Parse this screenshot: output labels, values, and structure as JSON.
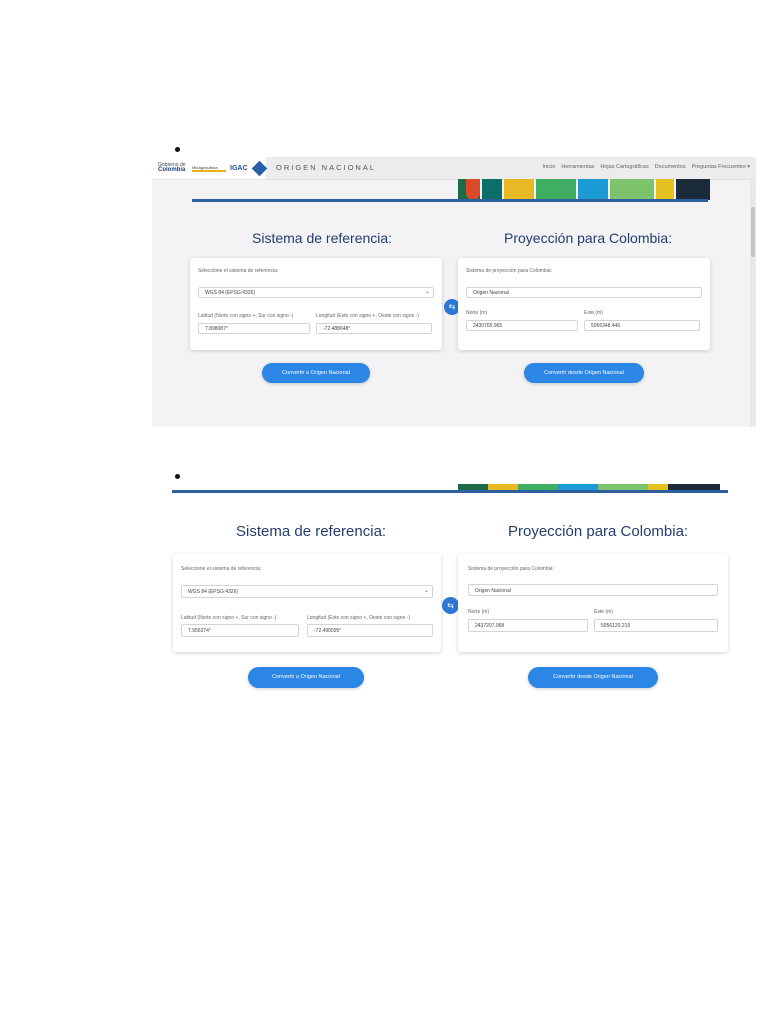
{
  "nav": {
    "logo_gov_small": "Gobierno de",
    "logo_gov": "Colombia",
    "logo_ministry": "MinAgricultura",
    "logo_igac": "IGAC",
    "brand": "ORIGEN NACIONAL",
    "menu": [
      "Inicio",
      "Herramientas",
      "Hojas Cartográficas",
      "Documentos",
      "Preguntas Frecuentes"
    ]
  },
  "shot1": {
    "left_title": "Sistema de referencia:",
    "right_title": "Proyección para Colombia:",
    "select_label": "Seleccione el sistema de referencia:",
    "select_value": "WGS 84 (EPSG:4326)",
    "lat_label": "Latitud (Norte con signo +, Sur con signo -)",
    "lat_value": "7.898087°",
    "lon_label": "Longitud (Este con signo +, Oeste con signo -)",
    "lon_value": "-72.488648°",
    "proj_label": "Sistema de proyección para Colombia:",
    "proj_value": "Origen Nacional",
    "north_label": "Norte (m)",
    "north_value": "2430765.965",
    "east_label": "Este (m)",
    "east_value": "5056348.446",
    "btn_to": "Convertir a Origen Nacional",
    "btn_from": "Convertir desde Origen Nacional"
  },
  "shot2": {
    "left_title": "Sistema de referencia:",
    "right_title": "Proyección para Colombia:",
    "select_label": "Seleccione el sistema de referencia:",
    "select_value": "WGS 84 (EPSG:4326)",
    "lat_label": "Latitud (Norte con signo +, Sur con signo -)",
    "lat_value": "7.956374°",
    "lon_label": "Longitud (Este con signo +, Oeste con signo -)",
    "lon_value": "-72.490595°",
    "proj_label": "Sistema de proyección para Colombia:",
    "proj_value": "Origen Nacional",
    "north_label": "Norte (m)",
    "north_value": "2437207.068",
    "east_label": "Este (m)",
    "east_value": "5056120.219",
    "btn_to": "Convertir a Origen Nacional",
    "btn_from": "Convertir desde Origen Nacional"
  },
  "icons": {
    "swap": "swap-arrows-icon",
    "chevron": "chevron-down-icon"
  },
  "colors": {
    "accent": "#2b86e6",
    "heading": "#243d6b",
    "rule": "#2e5f9e"
  }
}
